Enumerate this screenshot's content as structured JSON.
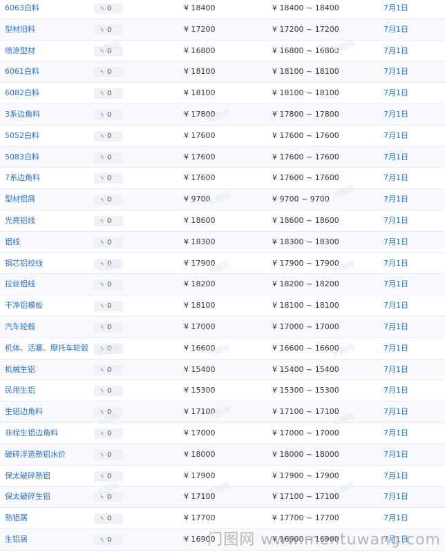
{
  "currency_symbol": "¥",
  "change_icon": "trend-icon",
  "rows": [
    {
      "name": "6063白料",
      "change": "0",
      "price": "¥ 18400",
      "range": "¥ 18400 ~ 18400",
      "date": "7月1日"
    },
    {
      "name": "型材旧料",
      "change": "0",
      "price": "¥ 17200",
      "range": "¥ 17200 ~ 17200",
      "date": "7月1日"
    },
    {
      "name": "喷涂型材",
      "change": "0",
      "price": "¥ 16800",
      "range": "¥ 16800 ~ 16800",
      "date": "7月1日"
    },
    {
      "name": "6061白料",
      "change": "0",
      "price": "¥ 18100",
      "range": "¥ 18100 ~ 18100",
      "date": "7月1日"
    },
    {
      "name": "6082白料",
      "change": "0",
      "price": "¥ 18100",
      "range": "¥ 18100 ~ 18100",
      "date": "7月1日"
    },
    {
      "name": "3系边角料",
      "change": "0",
      "price": "¥ 17800",
      "range": "¥ 17800 ~ 17800",
      "date": "7月1日"
    },
    {
      "name": "5052白料",
      "change": "0",
      "price": "¥ 17600",
      "range": "¥ 17600 ~ 17600",
      "date": "7月1日"
    },
    {
      "name": "5083白料",
      "change": "0",
      "price": "¥ 17600",
      "range": "¥ 17600 ~ 17600",
      "date": "7月1日"
    },
    {
      "name": "7系边角料",
      "change": "0",
      "price": "¥ 17600",
      "range": "¥ 17600 ~ 17600",
      "date": "7月1日"
    },
    {
      "name": "型材铝屑",
      "change": "0",
      "price": "¥ 9700",
      "range": "¥ 9700 ~ 9700",
      "date": "7月1日"
    },
    {
      "name": "光亮铝线",
      "change": "0",
      "price": "¥ 18600",
      "range": "¥ 18600 ~ 18600",
      "date": "7月1日"
    },
    {
      "name": "铝线",
      "change": "0",
      "price": "¥ 18300",
      "range": "¥ 18300 ~ 18300",
      "date": "7月1日"
    },
    {
      "name": "钢芯铝绞线",
      "change": "0",
      "price": "¥ 17900",
      "range": "¥ 17900 ~ 17900",
      "date": "7月1日"
    },
    {
      "name": "拉丝铝线",
      "change": "0",
      "price": "¥ 18200",
      "range": "¥ 18200 ~ 18200",
      "date": "7月1日"
    },
    {
      "name": "干净铝模板",
      "change": "0",
      "price": "¥ 18100",
      "range": "¥ 18100 ~ 18100",
      "date": "7月1日"
    },
    {
      "name": "汽车轮毂",
      "change": "0",
      "price": "¥ 17000",
      "range": "¥ 17000 ~ 17000",
      "date": "7月1日"
    },
    {
      "name": "机体、活塞、摩托车轮毂",
      "change": "0",
      "price": "¥ 16600",
      "range": "¥ 16600 ~ 16600",
      "date": "7月1日"
    },
    {
      "name": "机械生铝",
      "change": "0",
      "price": "¥ 15400",
      "range": "¥ 15400 ~ 15400",
      "date": "7月1日"
    },
    {
      "name": "民用生铝",
      "change": "0",
      "price": "¥ 15300",
      "range": "¥ 15300 ~ 15300",
      "date": "7月1日"
    },
    {
      "name": "生铝边角料",
      "change": "0",
      "price": "¥ 17100",
      "range": "¥ 17100 ~ 17100",
      "date": "7月1日"
    },
    {
      "name": "非标生铝边角料",
      "change": "0",
      "price": "¥ 17000",
      "range": "¥ 17000 ~ 17000",
      "date": "7月1日"
    },
    {
      "name": "破碎浮选熟铝水价",
      "change": "0",
      "price": "¥ 18000",
      "range": "¥ 18000 ~ 18000",
      "date": "7月1日"
    },
    {
      "name": "保太破碎熟铝",
      "change": "0",
      "price": "¥ 17900",
      "range": "¥ 17900 ~ 17900",
      "date": "7月1日"
    },
    {
      "name": "保太破碎生铝",
      "change": "0",
      "price": "¥ 17100",
      "range": "¥ 17100 ~ 17100",
      "date": "7月1日"
    },
    {
      "name": "熟铝屑",
      "change": "0",
      "price": "¥ 17700",
      "range": "¥ 17700 ~ 17700",
      "date": "7月1日"
    },
    {
      "name": "生铝屑",
      "change": "0",
      "price": "¥ 16900",
      "range": "¥ 16900 ~ 16900",
      "date": "7月1日"
    }
  ],
  "watermark": {
    "text": "大圆网",
    "footer": "门图网 www.mentuwang.com"
  }
}
